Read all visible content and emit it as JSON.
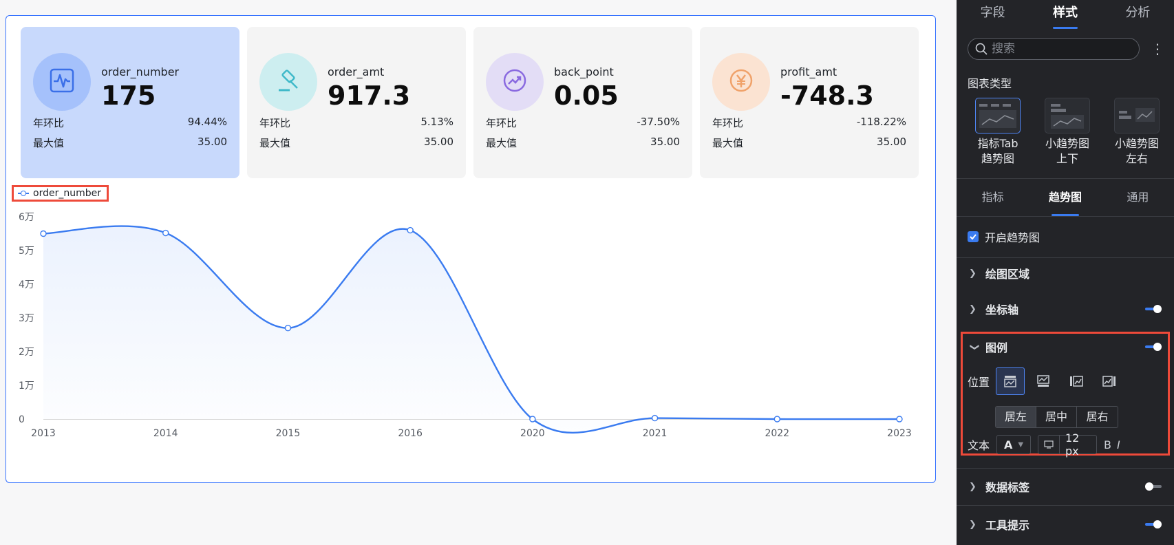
{
  "kpis": [
    {
      "name": "order_number",
      "value": "175",
      "yoy_label": "年环比",
      "yoy": "94.44%",
      "max_label": "最大值",
      "max": "35.00",
      "icon": "heartbeat-icon",
      "circle_color": "#a5c1fb",
      "icon_color": "#3a6fe8",
      "active": true
    },
    {
      "name": "order_amt",
      "value": "917.3",
      "yoy_label": "年环比",
      "yoy": "5.13%",
      "max_label": "最大值",
      "max": "35.00",
      "icon": "gavel-icon",
      "circle_color": "#cdeef0",
      "icon_color": "#3fb9c9",
      "active": false
    },
    {
      "name": "back_point",
      "value": "0.05",
      "yoy_label": "年环比",
      "yoy": "-37.50%",
      "max_label": "最大值",
      "max": "35.00",
      "icon": "trend-up-icon",
      "circle_color": "#e3ddf6",
      "icon_color": "#8a6ae0",
      "active": false
    },
    {
      "name": "profit_amt",
      "value": "-748.3",
      "yoy_label": "年环比",
      "yoy": "-118.22%",
      "max_label": "最大值",
      "max": "35.00",
      "icon": "yuan-icon",
      "circle_color": "#fbe3d2",
      "icon_color": "#f0a26a",
      "active": false
    }
  ],
  "chart_data": {
    "type": "area",
    "x": [
      "2013",
      "2014",
      "2015",
      "2016",
      "2020",
      "2021",
      "2022",
      "2023"
    ],
    "series": [
      {
        "name": "order_number",
        "values": [
          55000,
          55200,
          27000,
          56000,
          0,
          300,
          0,
          0
        ]
      }
    ],
    "y_ticks": [
      "0",
      "1万",
      "2万",
      "3万",
      "4万",
      "5万",
      "6万"
    ],
    "ylim": [
      0,
      60000
    ],
    "legend": "top-left",
    "color": "#3a7bf0"
  },
  "panel": {
    "tabs": [
      "字段",
      "样式",
      "分析"
    ],
    "search_placeholder": "搜索",
    "chart_type_label": "图表类型",
    "chart_types": [
      {
        "label1": "指标Tab",
        "label2": "趋势图"
      },
      {
        "label1": "小趋势图",
        "label2": "上下"
      },
      {
        "label1": "小趋势图",
        "label2": "左右"
      }
    ],
    "subtabs": [
      "指标",
      "趋势图",
      "通用"
    ],
    "enable_trend": "开启趋势图",
    "sections": {
      "plot_area": "绘图区域",
      "axis": "坐标轴",
      "legend": "图例",
      "data_label": "数据标签",
      "tooltip": "工具提示"
    },
    "position_label": "位置",
    "align": [
      "居左",
      "居中",
      "居右"
    ],
    "text_label": "文本",
    "font_glyph": "A",
    "font_size": "12 px",
    "bold": "B",
    "italic": "I"
  }
}
